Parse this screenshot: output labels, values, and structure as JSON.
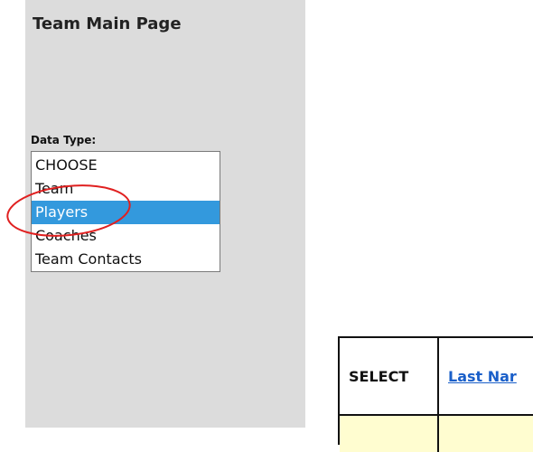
{
  "page": {
    "title": "Team Main Page"
  },
  "data_type": {
    "label": "Data Type:",
    "options": [
      "CHOOSE",
      "Team",
      "Players",
      "Coaches",
      "Team Contacts"
    ],
    "selected": "Players"
  },
  "table": {
    "columns": [
      "SELECT",
      "Last Nar"
    ]
  },
  "colors": {
    "sidebar_bg": "#dcdcdc",
    "selected_option_bg": "#3399dd",
    "annotation_circle": "#e02020",
    "link": "#1a5fc9",
    "row_bg": "#fffdd0"
  }
}
